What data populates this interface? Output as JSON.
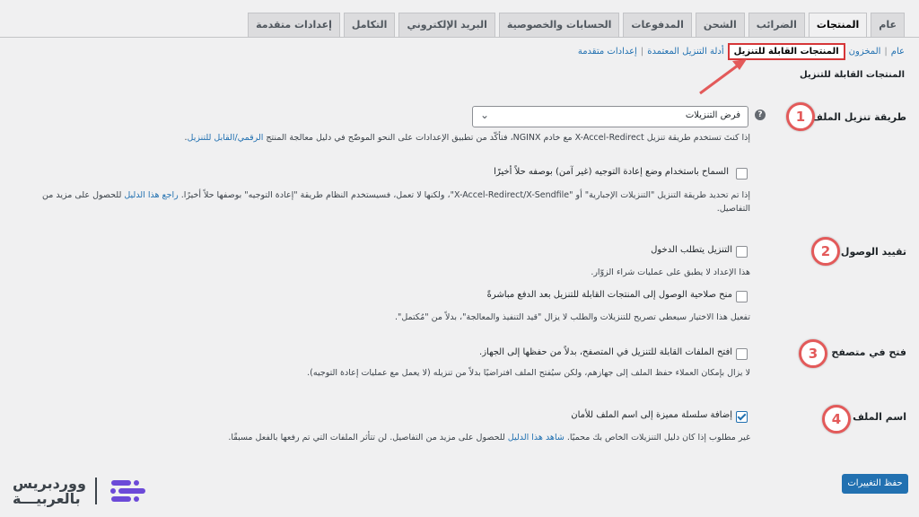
{
  "tabs": [
    {
      "label": "عام"
    },
    {
      "label": "المنتجات",
      "active": true
    },
    {
      "label": "الضرائب"
    },
    {
      "label": "الشحن"
    },
    {
      "label": "المدفوعات"
    },
    {
      "label": "الحسابات والخصوصية"
    },
    {
      "label": "البريد الإلكتروني"
    },
    {
      "label": "التكامل"
    },
    {
      "label": "إعدادات متقدمة"
    }
  ],
  "subnav": {
    "general": "عام",
    "stock": "المخزون",
    "downloadable": "المنتجات القابلة للتنزيل",
    "approved_dirs": "أدلة التنزيل المعتمدة",
    "advanced": "إعدادات متقدمة",
    "sep": "|"
  },
  "section_title": "المنتجات القابلة للتنزيل",
  "rows": {
    "method": {
      "label": "طريقة تنزيل الملف",
      "number": "1",
      "select_value": "فرض التنزيلات",
      "desc_pre": "إذا كنتَ تستخدم طريقة تنزيل X-Accel-Redirect مع خادم NGINX، فتأكّد من تطبيق الإعدادات على النحو الموضّح في دليل معالجة المنتج ",
      "desc_link": "الرقمي/القابل للتنزيل",
      "desc_post": ".",
      "checkbox_label": "السماح باستخدام وضع إعادة التوجيه (غير آمن) بوصفه حلاً أخيرًا",
      "note_pre": "إذا تم تحديد طريقة التنزيل \"التنزيلات الإجبارية\" أو \"X-Accel-Redirect/X-Sendfile\"، ولكنها لا تعمل، فسيستخدم النظام طريقة \"إعادة التوجيه\" بوصفها حلاً أخيرًا. ",
      "note_link": "راجع هذا الدليل",
      "note_post": " للحصول على مزيد من التفاصيل."
    },
    "access": {
      "label": "تقييد الوصول",
      "number": "2",
      "checkbox1": "التنزيل يتطلب الدخول",
      "desc1": "هذا الإعداد لا يطبق على عمليات شراء الزوّار.",
      "checkbox2": "منح صلاحية الوصول إلى المنتجات القابلة للتنزيل بعد الدفع مباشرةً",
      "desc2": "تفعيل هذا الاختيار سيعطي تصريح للتنزيلات والطلب لا يزال \"قيد التنفيذ والمعالجة\"، بدلاً من \"مُكتمل\"."
    },
    "browser": {
      "label": "فتح في متصفح",
      "number": "3",
      "checkbox": "افتح الملفات القابلة للتنزيل في المتصفح، بدلاً من حفظها إلى الجهاز.",
      "desc": "لا يزال بإمكان العملاء حفظ الملف إلى جهازهم، ولكن سيُفتح الملف افتراضيًا بدلاً من تنزيله (لا يعمل مع عمليات إعادة التوجيه)."
    },
    "filename": {
      "label": "اسم الملف",
      "number": "4",
      "checkbox": "إضافة سلسلة مميزة إلى اسم الملف للأمان",
      "checked": true,
      "desc_pre": "غير مطلوب إذا كان دليل التنزيلات الخاص بك محميًا. ",
      "desc_link": "شاهد هذا الدليل",
      "desc_post": " للحصول على مزيد من التفاصيل. لن تتأثر الملفات التي تم رفعها بالفعل مسبقًا."
    }
  },
  "save_label": "حفظ التغييرات",
  "logo": {
    "line1": "ووردبريس",
    "line2": "بالعربيـــة"
  },
  "colors": {
    "accent": "#2271b1",
    "highlight": "#d63638",
    "badge": "#e35a5a",
    "logo_purple": "#6c4ad8"
  }
}
